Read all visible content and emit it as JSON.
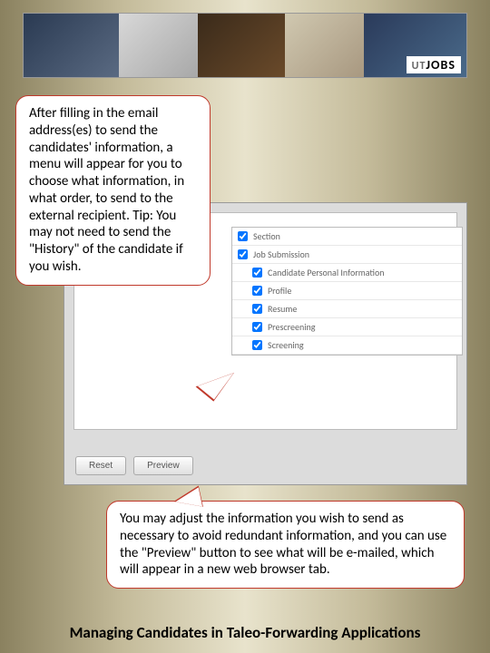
{
  "banner": {
    "logo_text": "JOBS",
    "logo_prefix": "UT"
  },
  "callout1": "After filling in the email address(es) to send the candidates' information, a menu will appear for you to choose what information, in what order, to send to the external recipient. Tip: You may not need to send the \"History\" of the candidate if you wish.",
  "callout2": "You may adjust the information you wish to send as necessary to avoid redundant information, and you can use the \"Preview\" button to see what will be e-mailed, which will appear in a new web browser tab.",
  "options": {
    "section": "Section",
    "job_submission": "Job Submission",
    "items": [
      "Candidate Personal Information",
      "Profile",
      "Resume",
      "Prescreening",
      "Screening"
    ]
  },
  "buttons": {
    "reset": "Reset",
    "preview": "Preview"
  },
  "footer": "Managing Candidates in Taleo-Forwarding Applications"
}
